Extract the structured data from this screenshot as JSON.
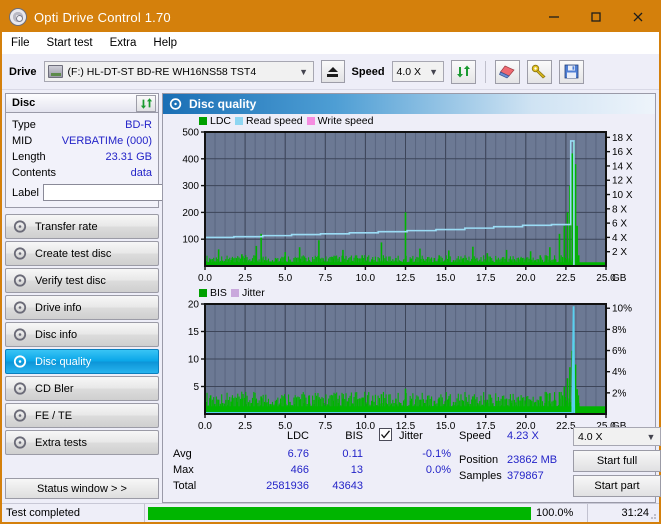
{
  "window": {
    "title": "Opti Drive Control 1.70",
    "app_icon": "disc-icon",
    "minimize": "minimize-icon",
    "maximize": "maximize-icon",
    "close": "close-icon"
  },
  "menu": {
    "items": [
      "File",
      "Start test",
      "Extra",
      "Help"
    ]
  },
  "toolbar": {
    "drive_label": "Drive",
    "drive_value": "(F:)  HL-DT-ST BD-RE  WH16NS58 TST4",
    "eject": "eject-icon",
    "speed_label": "Speed",
    "speed_value": "4.0 X",
    "refresh": "refresh-icon",
    "erase": "eraser-icon",
    "tools": "tools-icon",
    "save": "save-icon"
  },
  "disc": {
    "panel_title": "Disc",
    "refresh_icon": "refresh-icon",
    "rows": [
      {
        "key": "Type",
        "value": "BD-R"
      },
      {
        "key": "MID",
        "value": "VERBATIMe (000)"
      },
      {
        "key": "Length",
        "value": "23.31 GB"
      },
      {
        "key": "Contents",
        "value": "data"
      }
    ],
    "label_key": "Label",
    "label_value": "",
    "label_button_icon": "disc-label-icon"
  },
  "sidebar": {
    "items": [
      {
        "label": "Transfer rate",
        "selected": false
      },
      {
        "label": "Create test disc",
        "selected": false
      },
      {
        "label": "Verify test disc",
        "selected": false
      },
      {
        "label": "Drive info",
        "selected": false
      },
      {
        "label": "Disc info",
        "selected": false
      },
      {
        "label": "Disc quality",
        "selected": true
      },
      {
        "label": "CD Bler",
        "selected": false
      },
      {
        "label": "FE / TE",
        "selected": false
      },
      {
        "label": "Extra tests",
        "selected": false
      }
    ],
    "status_button": "Status window > >"
  },
  "main": {
    "title": "Disc quality",
    "title_icon": "disc-quality-icon"
  },
  "stats": {
    "col_ldc": "LDC",
    "col_bis": "BIS",
    "col_jitter": "Jitter",
    "jitter_checked": true,
    "rows": [
      {
        "name": "Avg",
        "ldc": "6.76",
        "bis": "0.11",
        "jitter": "-0.1%"
      },
      {
        "name": "Max",
        "ldc": "466",
        "bis": "13",
        "jitter": "0.0%"
      },
      {
        "name": "Total",
        "ldc": "2581936",
        "bis": "43643",
        "jitter": ""
      }
    ]
  },
  "readout": {
    "speed_label": "Speed",
    "speed_value": "4.23 X",
    "position_label": "Position",
    "position_value": "23862 MB",
    "samples_label": "Samples",
    "samples_value": "379867",
    "speed_select": "4.0 X",
    "start_full": "Start full",
    "start_part": "Start part"
  },
  "statusbar": {
    "message": "Test completed",
    "progress_percent": 100.0,
    "progress_text": "100.0%",
    "elapsed": "31:24"
  },
  "chart_data": [
    {
      "id": "top",
      "type": "area",
      "title": "",
      "xlabel": "GB",
      "ylabel": "LDC",
      "xlim": [
        0,
        25
      ],
      "ylim": [
        0,
        500
      ],
      "xticks": [
        "0.0",
        "2.5",
        "5.0",
        "7.5",
        "10.0",
        "12.5",
        "15.0",
        "17.5",
        "20.0",
        "22.5",
        "25.0"
      ],
      "xtickvals": [
        0,
        2.5,
        5,
        7.5,
        10,
        12.5,
        15,
        17.5,
        20,
        22.5,
        25
      ],
      "yticks": [
        "100",
        "200",
        "300",
        "400",
        "500"
      ],
      "ytickvals": [
        100,
        200,
        300,
        400,
        500
      ],
      "y2label": "X",
      "y2lim": [
        0,
        18.75
      ],
      "y2ticks": [
        "2 X",
        "4 X",
        "6 X",
        "8 X",
        "10 X",
        "12 X",
        "14 X",
        "16 X",
        "18 X"
      ],
      "y2tickvals": [
        2,
        4,
        6,
        8,
        10,
        12,
        14,
        16,
        18
      ],
      "grid": true,
      "legend": [
        {
          "name": "LDC",
          "color": "#00a000"
        },
        {
          "name": "Read speed",
          "color": "#8ed6f2"
        },
        {
          "name": "Write speed",
          "color": "#f58ce0"
        }
      ],
      "series": [
        {
          "name": "LDC",
          "color": "#00b400",
          "kind": "spikes",
          "baseline": 14,
          "x": [
            0.1,
            0.35,
            0.6,
            0.85,
            1.1,
            1.4,
            1.7,
            2.0,
            2.3,
            2.6,
            2.9,
            3.2,
            3.5,
            3.8,
            4.1,
            4.4,
            4.7,
            5.0,
            5.3,
            5.6,
            5.9,
            6.2,
            6.5,
            6.8,
            7.1,
            7.4,
            7.7,
            8.0,
            8.3,
            8.6,
            8.9,
            9.2,
            9.5,
            9.8,
            10.1,
            10.4,
            10.7,
            11.0,
            11.3,
            11.6,
            11.9,
            12.2,
            12.5,
            12.8,
            13.1,
            13.4,
            13.7,
            14.0,
            14.3,
            14.6,
            14.9,
            15.2,
            15.5,
            15.8,
            16.1,
            16.4,
            16.7,
            17.0,
            17.3,
            17.6,
            17.9,
            18.2,
            18.5,
            18.8,
            19.1,
            19.4,
            19.7,
            20.0,
            20.3,
            20.6,
            20.9,
            21.2,
            21.5,
            21.8,
            22.1,
            22.4,
            22.6,
            22.75,
            22.9,
            23.0,
            23.1,
            23.2,
            23.3
          ],
          "y": [
            18,
            25,
            16,
            62,
            20,
            15,
            30,
            18,
            44,
            22,
            17,
            75,
            120,
            20,
            16,
            30,
            18,
            52,
            24,
            16,
            70,
            19,
            22,
            17,
            96,
            20,
            15,
            28,
            18,
            60,
            22,
            17,
            30,
            40,
            18,
            25,
            16,
            88,
            20,
            15,
            30,
            18,
            200,
            26,
            17,
            65,
            20,
            16,
            30,
            40,
            18,
            58,
            22,
            16,
            30,
            18,
            72,
            20,
            15,
            48,
            18,
            24,
            16,
            60,
            20,
            15,
            30,
            18,
            55,
            22,
            40,
            18,
            70,
            26,
            120,
            150,
            200,
            300,
            420,
            466,
            380,
            150,
            40
          ]
        },
        {
          "name": "Read speed",
          "color": "#9bdcf5",
          "kind": "step-line",
          "x": [
            0,
            1.8,
            3.6,
            5.4,
            7.2,
            9.0,
            10.8,
            12.6,
            14.4,
            16.2,
            18.0,
            19.8,
            21.6,
            22.8,
            23.0,
            23.05
          ],
          "y": [
            3.8,
            4.0,
            4.1,
            4.25,
            4.4,
            4.5,
            4.65,
            4.8,
            4.95,
            5.1,
            5.3,
            5.5,
            5.7,
            5.8,
            17.5,
            0
          ]
        },
        {
          "name": "Write speed",
          "color": "#f58ce0",
          "kind": "line",
          "x": [],
          "y": []
        }
      ]
    },
    {
      "id": "bottom",
      "type": "area",
      "title": "",
      "xlabel": "GB",
      "ylabel": "BIS",
      "xlim": [
        0,
        25
      ],
      "ylim": [
        0,
        20
      ],
      "xticks": [
        "0.0",
        "2.5",
        "5.0",
        "7.5",
        "10.0",
        "12.5",
        "15.0",
        "17.5",
        "20.0",
        "22.5",
        "25.0"
      ],
      "xtickvals": [
        0,
        2.5,
        5,
        7.5,
        10,
        12.5,
        15,
        17.5,
        20,
        22.5,
        25
      ],
      "yticks": [
        "5",
        "10",
        "15",
        "20"
      ],
      "ytickvals": [
        5,
        10,
        15,
        20
      ],
      "y2label": "%",
      "y2lim": [
        0,
        10.4
      ],
      "y2ticks": [
        "2%",
        "4%",
        "6%",
        "8%",
        "10%"
      ],
      "y2tickvals": [
        2,
        4,
        6,
        8,
        10
      ],
      "grid": true,
      "legend": [
        {
          "name": "BIS",
          "color": "#00a000"
        },
        {
          "name": "Jitter",
          "color": "#c9a8dc"
        }
      ],
      "series": [
        {
          "name": "BIS",
          "color": "#00b400",
          "kind": "spikes",
          "baseline": 1.4,
          "x": [
            0.1,
            0.35,
            0.6,
            0.85,
            1.1,
            1.4,
            1.7,
            2.0,
            2.3,
            2.6,
            2.9,
            3.2,
            3.5,
            3.8,
            4.1,
            4.4,
            4.7,
            5.0,
            5.3,
            5.6,
            5.9,
            6.2,
            6.5,
            6.8,
            7.1,
            7.4,
            7.7,
            8.0,
            8.3,
            8.6,
            8.9,
            9.2,
            9.5,
            9.8,
            10.1,
            10.4,
            10.7,
            11.0,
            11.3,
            11.6,
            11.9,
            12.2,
            12.5,
            12.8,
            13.1,
            13.4,
            13.7,
            14.0,
            14.3,
            14.6,
            14.9,
            15.2,
            15.5,
            15.8,
            16.1,
            16.4,
            16.7,
            17.0,
            17.3,
            17.6,
            17.9,
            18.2,
            18.5,
            18.8,
            19.1,
            19.4,
            19.7,
            20.0,
            20.3,
            20.6,
            20.9,
            21.2,
            21.5,
            21.8,
            22.1,
            22.4,
            22.6,
            22.75,
            22.9,
            23.0,
            23.1,
            23.2,
            23.3
          ],
          "y": [
            2.2,
            3.4,
            1.8,
            2.6,
            2.0,
            1.6,
            3.0,
            2.2,
            2.8,
            1.8,
            2.0,
            2.6,
            3.2,
            2.0,
            1.8,
            2.4,
            2.0,
            2.8,
            2.2,
            1.8,
            2.6,
            2.0,
            3.4,
            1.8,
            2.6,
            2.0,
            1.6,
            2.4,
            2.0,
            2.8,
            2.2,
            1.8,
            2.6,
            3.0,
            1.8,
            2.4,
            1.6,
            3.6,
            2.0,
            1.6,
            2.8,
            2.0,
            4.6,
            2.4,
            1.8,
            2.6,
            2.0,
            1.6,
            2.4,
            3.0,
            1.8,
            2.8,
            2.2,
            1.6,
            2.4,
            1.8,
            3.2,
            2.0,
            1.6,
            2.6,
            1.8,
            2.4,
            1.6,
            2.8,
            2.0,
            1.6,
            2.4,
            1.8,
            2.6,
            2.2,
            3.2,
            2.0,
            3.8,
            2.6,
            4.0,
            5.0,
            6.5,
            8.5,
            11.5,
            13.0,
            9.0,
            4.5,
            2.0
          ]
        },
        {
          "name": "Jitter",
          "color": "#5ad0ef",
          "kind": "line",
          "x": [
            0,
            22.9,
            22.98,
            23.02
          ],
          "y": [
            0.2,
            0.2,
            19.6,
            0
          ]
        }
      ]
    }
  ]
}
